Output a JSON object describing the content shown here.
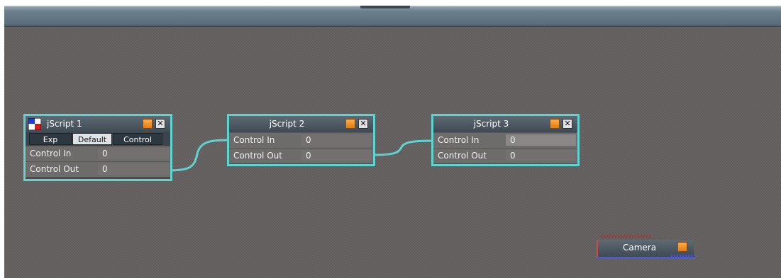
{
  "colors": {
    "node_border": "#5fd3d0",
    "titlebar": "#4b5660",
    "row": "#6e6b6b",
    "accent_button": "#f28c1c",
    "canvas": "#5f5b5a"
  },
  "nodes": [
    {
      "title": "jScript 1",
      "tabs": [
        "Exp",
        "Default",
        "Control"
      ],
      "rows": [
        {
          "label": "Control In",
          "value": "0"
        },
        {
          "label": "Control Out",
          "value": "0"
        }
      ]
    },
    {
      "title": "jScript 2",
      "rows": [
        {
          "label": "Control In",
          "value": "0"
        },
        {
          "label": "Control Out",
          "value": "0"
        }
      ]
    },
    {
      "title": "jScript 3",
      "rows": [
        {
          "label": "Control In",
          "value": "0"
        },
        {
          "label": "Control Out",
          "value": "0"
        }
      ]
    }
  ],
  "camera": {
    "title": "Camera"
  },
  "icons": {
    "node_type": "script-node-icon",
    "activate": "orange-square-button",
    "close": "close-icon"
  },
  "glyphs": {
    "close": "✕"
  }
}
